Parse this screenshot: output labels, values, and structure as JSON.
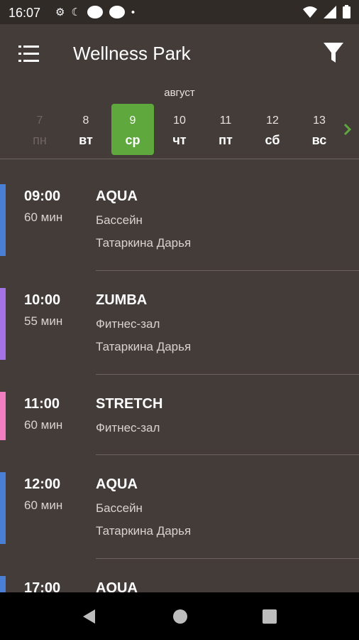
{
  "status_bar": {
    "time": "16:07"
  },
  "app_bar": {
    "title": "Wellness Park"
  },
  "calendar": {
    "month": "август",
    "days": [
      {
        "num": "7",
        "weekday": "пн",
        "state": "past"
      },
      {
        "num": "8",
        "weekday": "вт",
        "state": "normal"
      },
      {
        "num": "9",
        "weekday": "ср",
        "state": "selected"
      },
      {
        "num": "10",
        "weekday": "чт",
        "state": "normal"
      },
      {
        "num": "11",
        "weekday": "пт",
        "state": "normal"
      },
      {
        "num": "12",
        "weekday": "сб",
        "state": "normal"
      },
      {
        "num": "13",
        "weekday": "вс",
        "state": "normal"
      }
    ]
  },
  "sessions": [
    {
      "time": "09:00",
      "duration": "60 мин",
      "name": "AQUA",
      "place": "Бассейн",
      "trainer": "Татаркина Дарья",
      "color": "#4a7fd6"
    },
    {
      "time": "10:00",
      "duration": "55 мин",
      "name": "ZUMBA",
      "place": "Фитнес-зал",
      "trainer": "Татаркина Дарья",
      "color": "#a474e6"
    },
    {
      "time": "11:00",
      "duration": "60 мин",
      "name": "STRETCH",
      "place": "Фитнес-зал",
      "trainer": "",
      "color": "#f07ec0"
    },
    {
      "time": "12:00",
      "duration": "60 мин",
      "name": "AQUA",
      "place": "Бассейн",
      "trainer": "Татаркина Дарья",
      "color": "#4a7fd6"
    },
    {
      "time": "17:00",
      "duration": "",
      "name": "AQUA",
      "place": "",
      "trainer": "",
      "color": "#4a7fd6"
    }
  ],
  "colors": {
    "background": "#443c39",
    "status_bar": "#312b28",
    "accent_green": "#5fa83e"
  }
}
